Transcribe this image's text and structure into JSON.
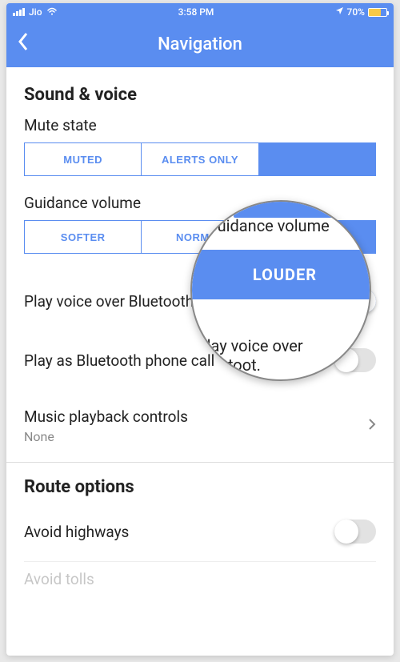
{
  "status": {
    "carrier": "Jio",
    "time": "3:58 PM",
    "battery_pct": "70%",
    "battery_fill_pct": 70
  },
  "header": {
    "title": "Navigation"
  },
  "sound_voice": {
    "section_title": "Sound & voice",
    "mute_state": {
      "label": "Mute state",
      "options": [
        "MUTED",
        "ALERTS ONLY",
        ""
      ],
      "selected_index": 2
    },
    "guidance_volume": {
      "label": "Guidance volume",
      "options": [
        "SOFTER",
        "NORMAL",
        "LOUDER"
      ],
      "selected_index": 2
    },
    "bluetooth": {
      "label": "Play voice over Bluetooth",
      "on": true
    },
    "bt_phone": {
      "label": "Play as Bluetooth phone call",
      "on": false
    },
    "music": {
      "label": "Music playback controls",
      "value": "None"
    }
  },
  "route_options": {
    "section_title": "Route options",
    "avoid_highways": {
      "label": "Avoid highways",
      "on": false
    },
    "avoid_tolls": {
      "label": "Avoid tolls"
    }
  },
  "magnifier": {
    "normal_fragment": "NORM",
    "louder": "LOUDER",
    "guidance_fragment": "Guidance volume",
    "bt_fragment": "Play voice over Bluetoot."
  }
}
